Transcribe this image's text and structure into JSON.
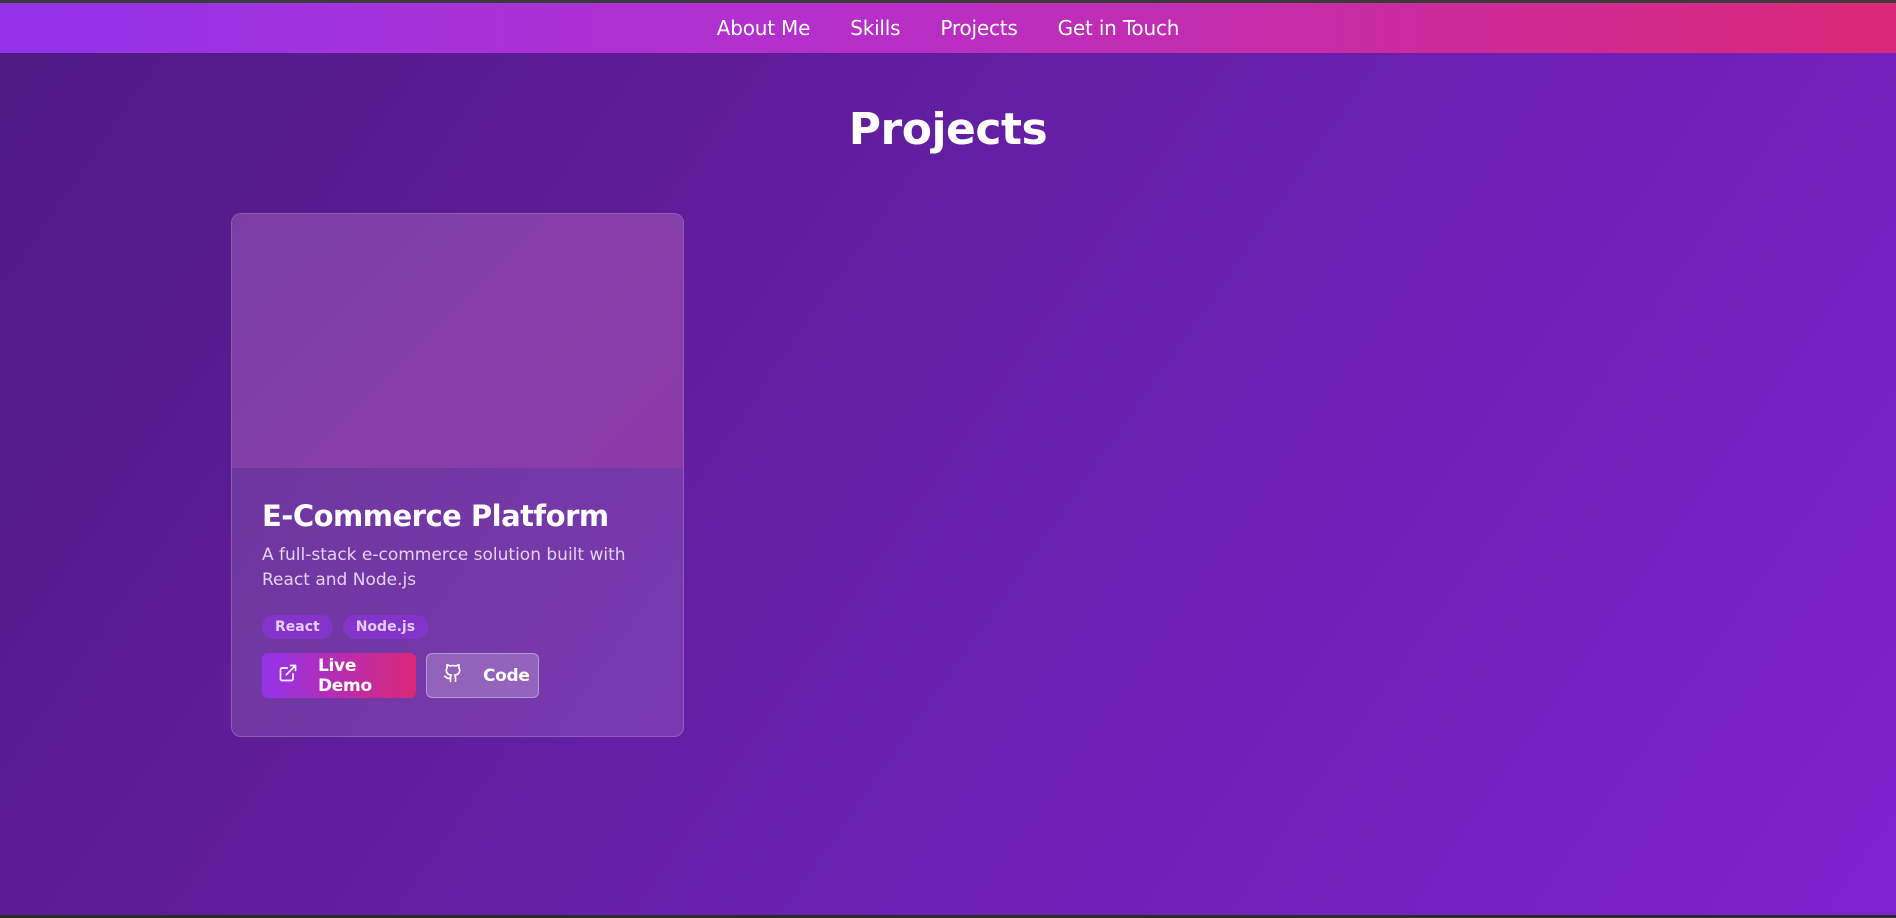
{
  "nav": {
    "items": [
      {
        "label": "About Me"
      },
      {
        "label": "Skills"
      },
      {
        "label": "Projects"
      },
      {
        "label": "Get in Touch"
      }
    ]
  },
  "section": {
    "title": "Projects"
  },
  "projects": [
    {
      "title": "E-Commerce Platform",
      "description": "A full-stack e-commerce solution built with React and Node.js",
      "tags": [
        "React",
        "Node.js"
      ],
      "live_label": "Live Demo",
      "live_icon": "external-link-icon",
      "code_label": "Code",
      "code_icon": "github-icon"
    }
  ],
  "colors": {
    "nav_gradient_start": "#9333ea",
    "nav_gradient_end": "#db2777",
    "background_start": "#4e1a83",
    "background_end": "#7e22ce"
  }
}
